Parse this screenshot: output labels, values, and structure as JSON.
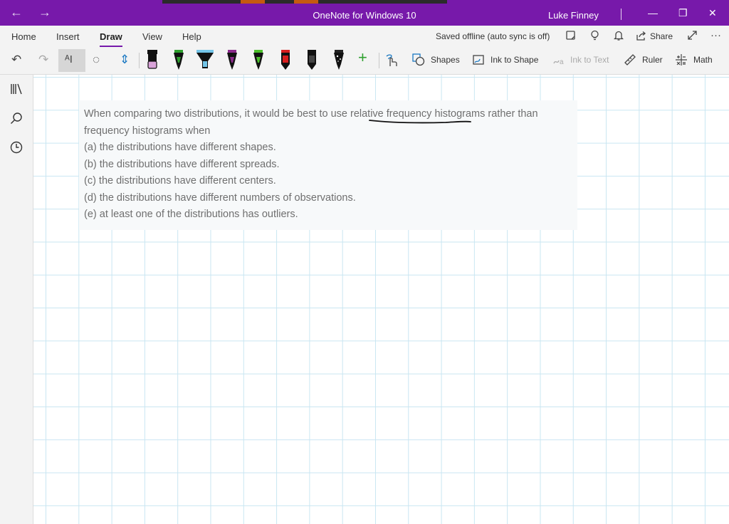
{
  "titlebar": {
    "title": "OneNote for Windows 10",
    "user": "Luke Finney",
    "back_glyph": "←",
    "forward_glyph": "→",
    "minimize_glyph": "—",
    "restore_glyph": "❐",
    "close_glyph": "✕"
  },
  "menu": {
    "tabs": [
      "Home",
      "Insert",
      "Draw",
      "View",
      "Help"
    ],
    "active_tab": "Draw",
    "sync_status": "Saved offline (auto sync is off)",
    "share_label": "Share",
    "more_glyph": "···"
  },
  "toolbar": {
    "undo_glyph": "↶",
    "redo_glyph": "↷",
    "lasso_text_glyph": "ᴬI",
    "lasso_glyph": "◌",
    "space_glyph": "⇕",
    "add_pen_glyph": "+",
    "shapes_label": "Shapes",
    "ink_to_shape_label": "Ink to Shape",
    "ink_to_text_label": "Ink to Text",
    "ruler_label": "Ruler",
    "math_label": "Math",
    "pens": [
      {
        "name": "highlighter-pink",
        "color": "#d9a3d9"
      },
      {
        "name": "pen-green",
        "color": "#2ea02e"
      },
      {
        "name": "highlighter-cyan",
        "color": "#74c5e8"
      },
      {
        "name": "pen-purple",
        "color": "#8c2a8c"
      },
      {
        "name": "pen-lime",
        "color": "#4bbf2b"
      },
      {
        "name": "pen-red",
        "color": "#d81e1e"
      },
      {
        "name": "pen-black",
        "color": "#111111"
      },
      {
        "name": "pen-black-galaxy",
        "color": "#222222"
      }
    ]
  },
  "sidebar": {
    "notebooks_glyph": "⫼",
    "search_glyph": "⚲",
    "recent_glyph": "◷"
  },
  "note": {
    "line1_pre": "When comparing two distributions, it would be best to use ",
    "line1_ul": "relative frequency",
    "line1_post": " histograms rather than",
    "line2": "frequency histograms when",
    "options": [
      "(a) the distributions have different shapes.",
      "(b) the distributions have different spreads.",
      "(c) the distributions have different centers.",
      "(d) the distributions have different numbers of observations.",
      "(e) at least one of the distributions has outliers."
    ]
  },
  "colors": {
    "titlebar": "#7719aa",
    "ribbon": "#f3f3f3",
    "grid": "#c9e6f2",
    "ink": "#111111"
  }
}
